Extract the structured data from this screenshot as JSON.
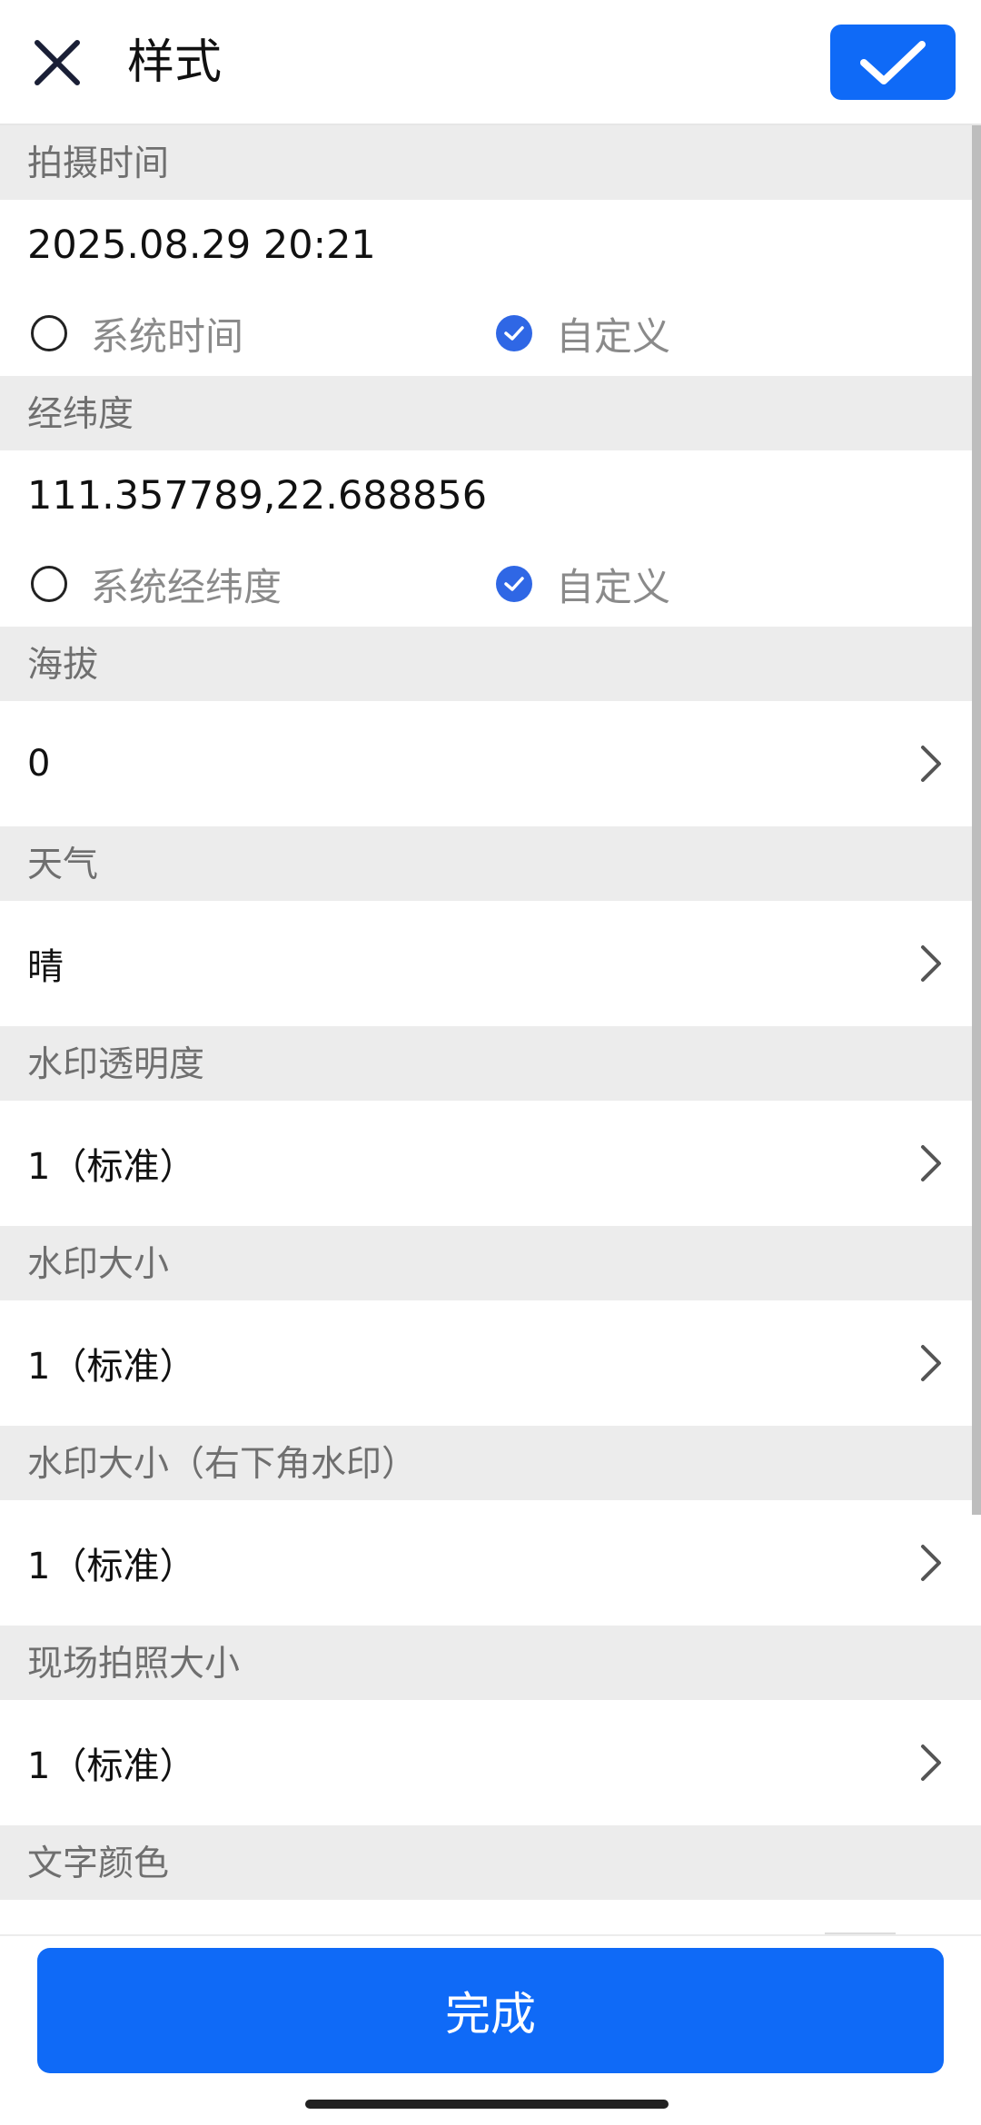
{
  "header": {
    "title": "样式",
    "close_icon": "close-icon",
    "confirm_icon": "check-icon"
  },
  "capture_time": {
    "label": "拍摄时间",
    "value": "2025.08.29 20:21",
    "options": [
      {
        "label": "系统时间",
        "selected": false
      },
      {
        "label": "自定义",
        "selected": true
      }
    ]
  },
  "coordinates": {
    "label": "经纬度",
    "value": "111.357789,22.688856",
    "options": [
      {
        "label": "系统经纬度",
        "selected": false
      },
      {
        "label": "自定义",
        "selected": true
      }
    ]
  },
  "altitude": {
    "label": "海拔",
    "value": "0"
  },
  "weather": {
    "label": "天气",
    "value": "晴"
  },
  "watermark_opacity": {
    "label": "水印透明度",
    "value": "1（标准）"
  },
  "watermark_size": {
    "label": "水印大小",
    "value": "1（标准）"
  },
  "watermark_size_corner": {
    "label": "水印大小（右下角水印）",
    "value": "1（标准）"
  },
  "photo_size": {
    "label": "现场拍照大小",
    "value": "1（标准）"
  },
  "text_color": {
    "label": "文字颜色"
  },
  "footer": {
    "done_label": "完成"
  },
  "colors": {
    "accent": "#0f6af7",
    "radio_checked": "#2f67e5",
    "section_bg": "#ececec"
  }
}
